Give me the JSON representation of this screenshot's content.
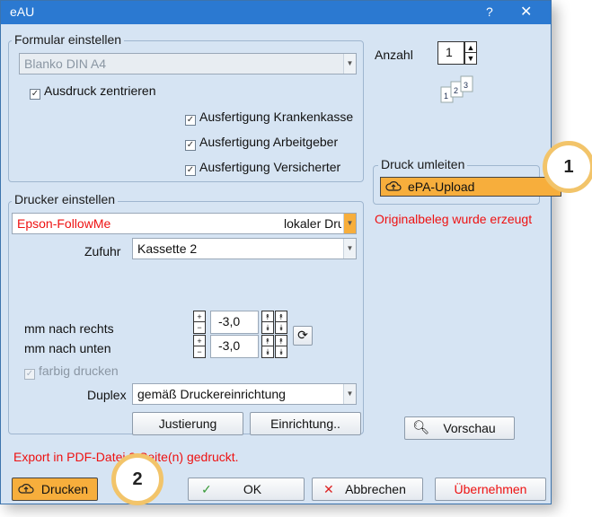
{
  "window": {
    "title": "eAU",
    "help": "?",
    "close": "✕"
  },
  "formular": {
    "group_title": "Formular einstellen",
    "template_value": "Blanko DIN A4",
    "center_print": "Ausdruck zentrieren",
    "copy_insurance": "Ausfertigung Krankenkasse",
    "copy_employer": "Ausfertigung Arbeitgeber",
    "copy_insured": "Ausfertigung Versicherter"
  },
  "anzahl": {
    "label": "Anzahl",
    "value": "1"
  },
  "redirect": {
    "group_title": "Druck umleiten",
    "value": "ePA-Upload",
    "status": "Originalbeleg wurde erzeugt"
  },
  "printer": {
    "group_title": "Drucker einstellen",
    "name": "Epson-FollowMe",
    "type": "lokaler Drucker",
    "feed_label": "Zufuhr",
    "feed_value": "Kassette 2",
    "right_label": "mm nach rechts",
    "right_value": "-3,0",
    "down_label": "mm nach unten",
    "down_value": "-3,0",
    "color_label": "farbig drucken",
    "duplex_label": "Duplex",
    "duplex_value": "gemäß Druckereinrichtung",
    "adjust_button": "Justierung",
    "setup_button": "Einrichtung.."
  },
  "preview_button": "Vorschau",
  "export_status": "Export in PDF-Datei 3 Seite(n) gedruckt.",
  "buttons": {
    "print": "Drucken",
    "ok": "OK",
    "cancel": "Abbrechen",
    "apply": "Übernehmen"
  },
  "callouts": {
    "one": "1",
    "two": "2"
  },
  "colors": {
    "titlebar": "#2b79d1",
    "dialog": "#d6e4f3",
    "highlight": "#f7ae3c",
    "error": "#e11111",
    "callout_ring": "#f2c46a"
  }
}
